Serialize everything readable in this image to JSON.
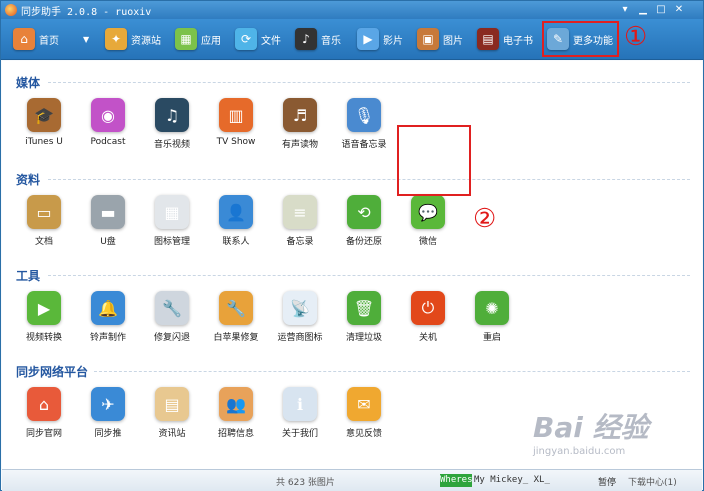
{
  "titlebar": {
    "title": "同步助手 2.0.8 - ruoxiv",
    "buttons": [
      "▾",
      "▁",
      "□",
      "✕"
    ]
  },
  "toolbar": [
    {
      "label": "首页",
      "icon": "home-icon",
      "color": "#e8823a",
      "glyph": "⌂"
    },
    {
      "label": "▼",
      "icon": "dropdown-icon",
      "color": "",
      "glyph": ""
    },
    {
      "label": "资源站",
      "icon": "bag-icon",
      "color": "#e7a93a",
      "glyph": "✦"
    },
    {
      "label": "应用",
      "icon": "apps-icon",
      "color": "#7cc24a",
      "glyph": "▦"
    },
    {
      "label": "文件",
      "icon": "file-sync-icon",
      "color": "#4fb4e8",
      "glyph": "⟳"
    },
    {
      "label": "音乐",
      "icon": "music-icon",
      "color": "#333333",
      "glyph": "♪"
    },
    {
      "label": "影片",
      "icon": "video-icon",
      "color": "#5aa6e6",
      "glyph": "▶"
    },
    {
      "label": "图片",
      "icon": "picture-icon",
      "color": "#c7793a",
      "glyph": "▣"
    },
    {
      "label": "电子书",
      "icon": "ebook-icon",
      "color": "#8a2a20",
      "glyph": "▤"
    },
    {
      "label": "更多功能",
      "icon": "more-icon",
      "color": "#6ca8d8",
      "glyph": "✎"
    }
  ],
  "annotations": {
    "one": "①",
    "two": "②"
  },
  "sections": [
    {
      "title": "媒体",
      "items": [
        {
          "label": "iTunes U",
          "icon": "itunes-u-icon",
          "color": "#a86a32",
          "glyph": "🎓"
        },
        {
          "label": "Podcast",
          "icon": "podcast-icon",
          "color": "#c252c8",
          "glyph": "◉"
        },
        {
          "label": "音乐视频",
          "icon": "music-video-icon",
          "color": "#2a4a62",
          "glyph": "♫"
        },
        {
          "label": "TV Show",
          "icon": "tv-show-icon",
          "color": "#e66a2a",
          "glyph": "▥"
        },
        {
          "label": "有声读物",
          "icon": "audiobook-icon",
          "color": "#8a5a32",
          "glyph": "♬"
        },
        {
          "label": "语音备忘录",
          "icon": "voice-memo-icon",
          "color": "#4a8ad0",
          "glyph": "🎙"
        }
      ]
    },
    {
      "title": "资料",
      "items": [
        {
          "label": "文档",
          "icon": "document-icon",
          "color": "#c89a4a",
          "glyph": "▭"
        },
        {
          "label": "U盘",
          "icon": "usb-disk-icon",
          "color": "#9aa4ac",
          "glyph": "▬"
        },
        {
          "label": "图标管理",
          "icon": "icon-manager-icon",
          "color": "#e2e6ea",
          "glyph": "▦"
        },
        {
          "label": "联系人",
          "icon": "contacts-icon",
          "color": "#3a8ad6",
          "glyph": "👤"
        },
        {
          "label": "备忘录",
          "icon": "memo-icon",
          "color": "#d8dcc8",
          "glyph": "≡"
        },
        {
          "label": "备份还原",
          "icon": "backup-restore-icon",
          "color": "#4fae3a",
          "glyph": "⟲"
        },
        {
          "label": "微信",
          "icon": "wechat-icon",
          "color": "#5ab83a",
          "glyph": "💬"
        }
      ]
    },
    {
      "title": "工具",
      "items": [
        {
          "label": "视频转换",
          "icon": "video-convert-icon",
          "color": "#5ab83a",
          "glyph": "▶"
        },
        {
          "label": "铃声制作",
          "icon": "ringtone-icon",
          "color": "#3a8ad6",
          "glyph": "🔔"
        },
        {
          "label": "修复闪退",
          "icon": "repair-crash-icon",
          "color": "#cfd6de",
          "glyph": "🔧"
        },
        {
          "label": "白苹果修复",
          "icon": "white-apple-fix-icon",
          "color": "#e8a23a",
          "glyph": "🔧"
        },
        {
          "label": "运营商图标",
          "icon": "carrier-icon",
          "color": "#e6eef6",
          "glyph": "📡"
        },
        {
          "label": "清理垃圾",
          "icon": "trash-cleanup-icon",
          "color": "#4fae3a",
          "glyph": "🗑"
        },
        {
          "label": "关机",
          "icon": "shutdown-icon",
          "color": "#e2481a",
          "glyph": "⏻"
        },
        {
          "label": "重启",
          "icon": "restart-icon",
          "color": "#4fae3a",
          "glyph": "✺"
        }
      ]
    },
    {
      "title": "同步网络平台",
      "items": [
        {
          "label": "同步官网",
          "icon": "official-site-icon",
          "color": "#e85a3a",
          "glyph": "⌂"
        },
        {
          "label": "同步推",
          "icon": "tongbu-push-icon",
          "color": "#3a8ad6",
          "glyph": "✈"
        },
        {
          "label": "资讯站",
          "icon": "news-icon",
          "color": "#e8c890",
          "glyph": "▤"
        },
        {
          "label": "招聘信息",
          "icon": "jobs-icon",
          "color": "#e8a25a",
          "glyph": "👥"
        },
        {
          "label": "关于我们",
          "icon": "about-icon",
          "color": "#d8e4f0",
          "glyph": "ℹ"
        },
        {
          "label": "意见反馈",
          "icon": "feedback-icon",
          "color": "#f0a830",
          "glyph": "✉"
        }
      ]
    }
  ],
  "statusbar": {
    "count": "共 623 张图片",
    "wheres": "Wheres",
    "track": "My Mickey_ XL_",
    "pause": "暂停",
    "downloads": "下载中心(1)"
  },
  "watermark": {
    "main": "Bai 经验",
    "sub": "jingyan.baidu.com"
  }
}
